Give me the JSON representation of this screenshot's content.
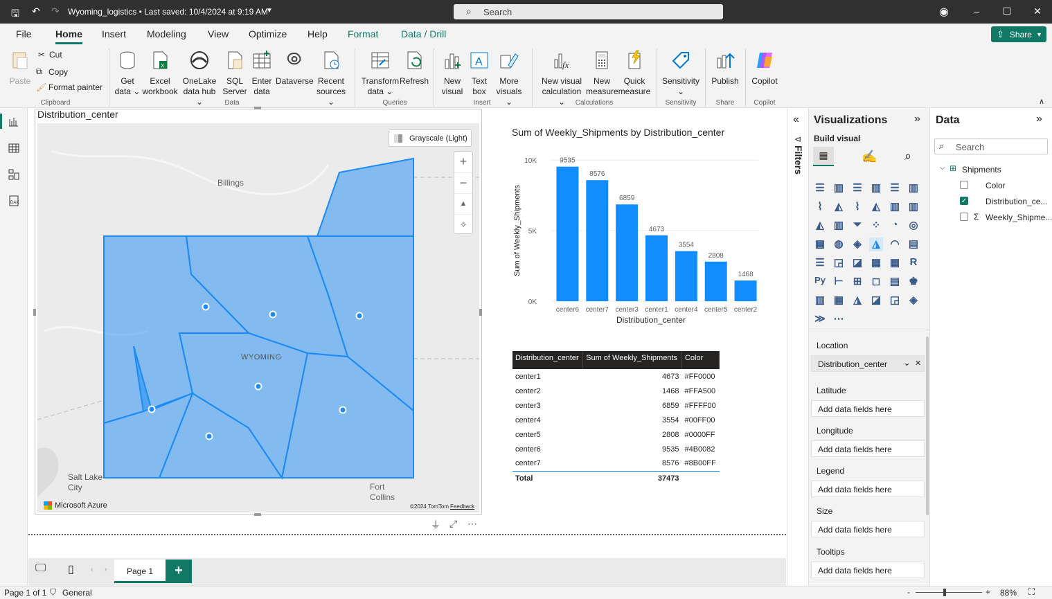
{
  "titlebar": {
    "title": "Wyoming_logistics • Last saved: 10/4/2024 at 9:19 AM",
    "search_placeholder": "Search"
  },
  "menu": {
    "items": [
      "File",
      "Home",
      "Insert",
      "Modeling",
      "View",
      "Optimize",
      "Help",
      "Format",
      "Data / Drill"
    ],
    "share": "Share"
  },
  "ribbon": {
    "clipboard": {
      "paste": "Paste",
      "cut": "Cut",
      "copy": "Copy",
      "format_painter": "Format painter",
      "group": "Clipboard"
    },
    "data": {
      "get_data": [
        "Get",
        "data"
      ],
      "excel": [
        "Excel",
        "workbook"
      ],
      "onelake": [
        "OneLake",
        "data hub"
      ],
      "sql": [
        "SQL",
        "Server"
      ],
      "enter": [
        "Enter",
        "data"
      ],
      "dataverse": "Dataverse",
      "recent": [
        "Recent",
        "sources"
      ],
      "group": "Data"
    },
    "queries": {
      "transform": [
        "Transform",
        "data"
      ],
      "refresh": "Refresh",
      "group": "Queries"
    },
    "insert": {
      "new_visual": [
        "New",
        "visual"
      ],
      "text_box": [
        "Text",
        "box"
      ],
      "more_visuals": [
        "More",
        "visuals"
      ],
      "group": "Insert"
    },
    "calculations": {
      "new_visual_calc": [
        "New visual",
        "calculation"
      ],
      "new_measure": [
        "New",
        "measure"
      ],
      "quick_measure": [
        "Quick",
        "measure"
      ],
      "group": "Calculations"
    },
    "sensitivity": {
      "label": "Sensitivity",
      "group": "Sensitivity"
    },
    "share": {
      "publish": "Publish",
      "group": "Share"
    },
    "copilot": {
      "label": "Copilot",
      "group": "Copilot"
    }
  },
  "map": {
    "title": "Distribution_center",
    "style_button": "Grayscale (Light)",
    "labels": {
      "billings": "Billings",
      "wyoming": "WYOMING",
      "salt_lake": [
        "Salt Lake",
        "City"
      ],
      "fort_collins": [
        "Fort",
        "Collins"
      ]
    },
    "attribution": "Microsoft Azure",
    "copyright": "©2024 TomTom",
    "feedback": "Feedback",
    "fill_color": "#1c8bf5"
  },
  "chart_data": [
    {
      "type": "bar",
      "title": "Sum of Weekly_Shipments by Distribution_center",
      "xlabel": "Distribution_center",
      "ylabel": "Sum of Weekly_Shipments",
      "categories": [
        "center6",
        "center7",
        "center3",
        "center1",
        "center4",
        "center5",
        "center2"
      ],
      "values": [
        9535,
        8576,
        6859,
        4673,
        3554,
        2808,
        1468
      ],
      "yticks": [
        "0K",
        "5K",
        "10K"
      ],
      "ylim": [
        0,
        10500
      ],
      "color": "#118DFF"
    },
    {
      "type": "table",
      "columns": [
        "Distribution_center",
        "Sum of Weekly_Shipments",
        "Color"
      ],
      "rows": [
        [
          "center1",
          "4673",
          "#FF0000"
        ],
        [
          "center2",
          "1468",
          "#FFA500"
        ],
        [
          "center3",
          "6859",
          "#FFFF00"
        ],
        [
          "center4",
          "3554",
          "#00FF00"
        ],
        [
          "center5",
          "2808",
          "#0000FF"
        ],
        [
          "center6",
          "9535",
          "#4B0082"
        ],
        [
          "center7",
          "8576",
          "#8B00FF"
        ]
      ],
      "total": {
        "label": "Total",
        "value": "37473"
      }
    }
  ],
  "pages": {
    "tab": "Page 1",
    "add": "+"
  },
  "status": {
    "page": "Page 1 of 1",
    "sensitivity": "General",
    "zoom": "88%"
  },
  "filters": {
    "label": "Filters"
  },
  "visualizations": {
    "title": "Visualizations",
    "build": "Build visual",
    "wells": [
      {
        "label": "Location",
        "value": "Distribution_center"
      },
      {
        "label": "Latitude",
        "value": "Add data fields here"
      },
      {
        "label": "Longitude",
        "value": "Add data fields here"
      },
      {
        "label": "Legend",
        "value": "Add data fields here"
      },
      {
        "label": "Size",
        "value": "Add data fields here"
      },
      {
        "label": "Tooltips",
        "value": "Add data fields here"
      }
    ]
  },
  "data_pane": {
    "title": "Data",
    "search": "Search",
    "table": "Shipments",
    "fields": [
      {
        "name": "Color",
        "checked": false,
        "sigma": false
      },
      {
        "name": "Distribution_ce...",
        "checked": true,
        "sigma": false
      },
      {
        "name": "Weekly_Shipme...",
        "checked": false,
        "sigma": true
      }
    ]
  }
}
